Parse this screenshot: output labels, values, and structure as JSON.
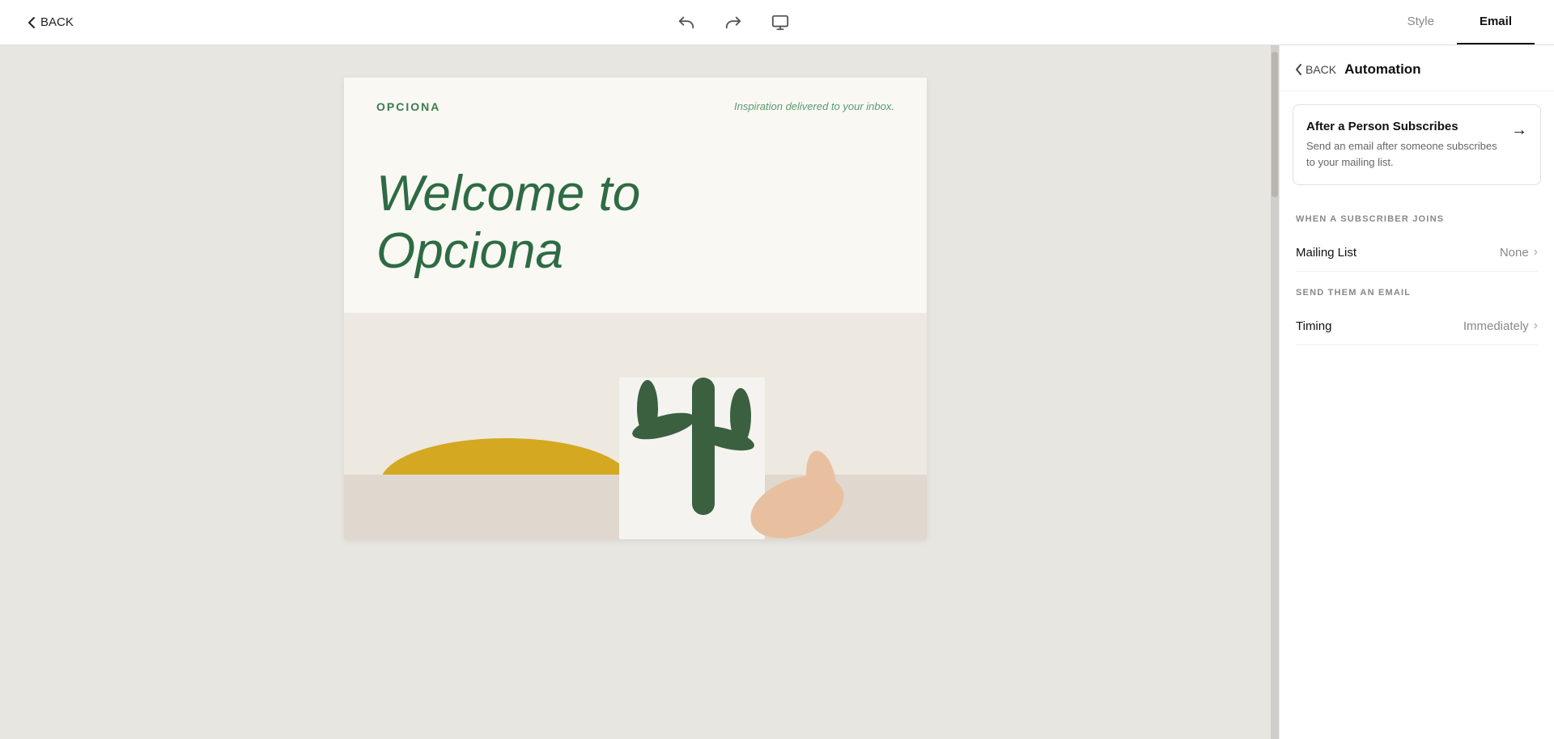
{
  "toolbar": {
    "back_label": "BACK",
    "undo_icon": "undo",
    "redo_icon": "redo",
    "desktop_icon": "desktop",
    "tab_style": "Style",
    "tab_email": "Email",
    "active_tab": "Email"
  },
  "right_panel": {
    "back_label": "BACK",
    "section_title": "Automation",
    "automation_card": {
      "title": "After a Person Subscribes",
      "description": "Send an email after someone subscribes to your mailing list."
    },
    "when_subscriber_joins": {
      "section_label": "WHEN A SUBSCRIBER JOINS",
      "mailing_list_label": "Mailing List",
      "mailing_list_value": "None"
    },
    "send_email": {
      "section_label": "SEND THEM AN EMAIL",
      "timing_label": "Timing",
      "timing_value": "Immediately"
    }
  },
  "email_preview": {
    "logo": "OPCIONA",
    "tagline": "Inspiration delivered to your inbox.",
    "headline_line1": "Welcome to",
    "headline_line2": "Opciona"
  }
}
